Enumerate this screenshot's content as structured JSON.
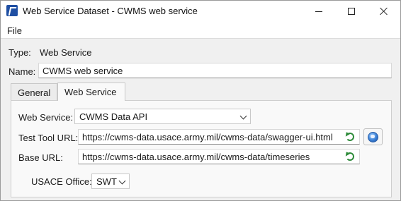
{
  "window": {
    "title": "Web Service Dataset - CWMS web service"
  },
  "menu": {
    "file_label": "File"
  },
  "type_row": {
    "label": "Type:",
    "value": "Web Service"
  },
  "name_row": {
    "label": "Name:",
    "value": "CWMS web service"
  },
  "tabs": [
    {
      "label": "General",
      "active": false
    },
    {
      "label": "Web Service",
      "active": true
    }
  ],
  "web_service_tab": {
    "service_label": "Web Service:",
    "service_value": "CWMS Data API",
    "test_tool_label": "Test Tool URL:",
    "test_tool_value": "https://cwms-data.usace.army.mil/cwms-data/swagger-ui.html",
    "base_url_label": "Base URL:",
    "base_url_value": "https://cwms-data.usace.army.mil/cwms-data/timeseries",
    "office_label": "USACE Office:",
    "office_value": "SWT"
  },
  "colors": {
    "refresh_icon": "#2e8b3a",
    "app_icon": "#1f4fa3"
  }
}
